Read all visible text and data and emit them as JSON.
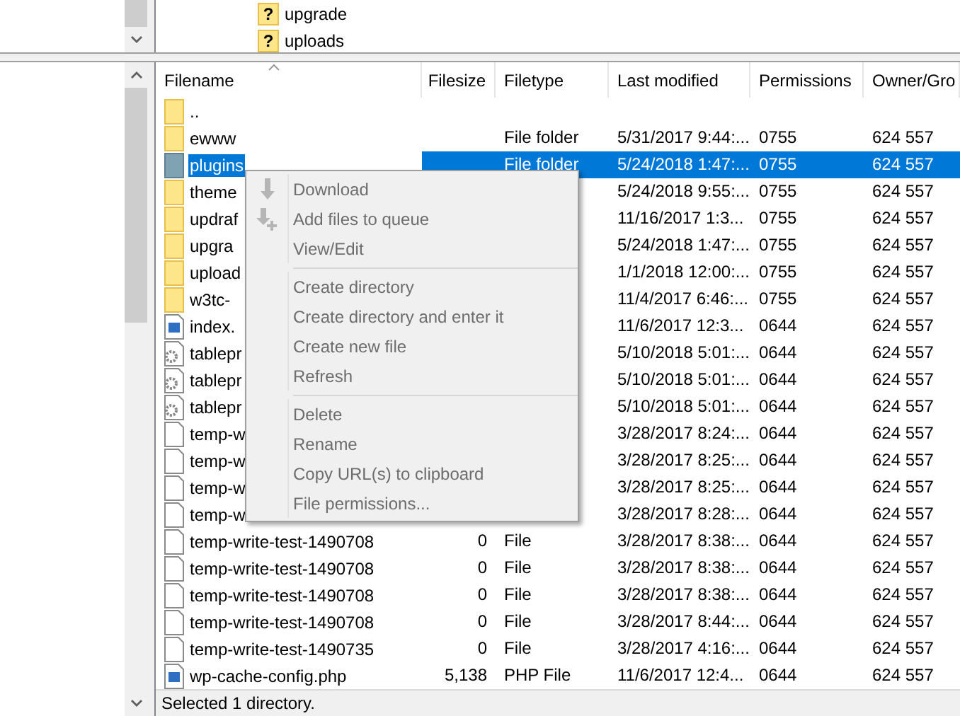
{
  "tree": {
    "items": [
      {
        "mark": "?",
        "label": "upgrade"
      },
      {
        "mark": "?",
        "label": "uploads"
      }
    ]
  },
  "file_list": {
    "columns": [
      {
        "label": "Filename",
        "sorted": true
      },
      {
        "label": "Filesize",
        "sorted": false
      },
      {
        "label": "Filetype",
        "sorted": false
      },
      {
        "label": "Last modified",
        "sorted": false
      },
      {
        "label": "Permissions",
        "sorted": false
      },
      {
        "label": "Owner/Gro",
        "sorted": false
      }
    ],
    "rows": [
      {
        "kind": "folder",
        "name": "..",
        "selected": false
      },
      {
        "kind": "folder",
        "name": "ewww",
        "filetype": "File folder",
        "modified": "5/31/2017 9:44:...",
        "permissions": "0755",
        "owner": "624 557",
        "selected": false
      },
      {
        "kind": "folder",
        "name": "plugins",
        "filetype": "File folder",
        "modified": "5/24/2018 1:47:...",
        "permissions": "0755",
        "owner": "624 557",
        "selected": true
      },
      {
        "kind": "folder",
        "name": "theme",
        "modified": "5/24/2018 9:55:...",
        "permissions": "0755",
        "owner": "624 557",
        "selected": false
      },
      {
        "kind": "folder",
        "name": "updraf",
        "modified": "11/16/2017 1:3...",
        "permissions": "0755",
        "owner": "624 557",
        "selected": false
      },
      {
        "kind": "folder",
        "name": "upgra",
        "modified": "5/24/2018 1:47:...",
        "permissions": "0755",
        "owner": "624 557",
        "selected": false
      },
      {
        "kind": "folder",
        "name": "upload",
        "modified": "1/1/2018 12:00:...",
        "permissions": "0755",
        "owner": "624 557",
        "selected": false
      },
      {
        "kind": "folder",
        "name": "w3tc-",
        "modified": "11/4/2017 6:46:...",
        "permissions": "0755",
        "owner": "624 557",
        "selected": false
      },
      {
        "kind": "php",
        "name": "index.",
        "modified": "11/6/2017 12:3...",
        "permissions": "0644",
        "owner": "624 557",
        "selected": false
      },
      {
        "kind": "gear",
        "name": "tablepr",
        "modified": "5/10/2018 5:01:...",
        "permissions": "0644",
        "owner": "624 557",
        "selected": false
      },
      {
        "kind": "gear",
        "name": "tablepr",
        "modified": "5/10/2018 5:01:...",
        "permissions": "0644",
        "owner": "624 557",
        "selected": false
      },
      {
        "kind": "gear",
        "name": "tablepr",
        "modified": "5/10/2018 5:01:...",
        "permissions": "0644",
        "owner": "624 557",
        "selected": false
      },
      {
        "kind": "file",
        "name": "temp-w",
        "modified": "3/28/2017 8:24:...",
        "permissions": "0644",
        "owner": "624 557",
        "selected": false
      },
      {
        "kind": "file",
        "name": "temp-w",
        "modified": "3/28/2017 8:25:...",
        "permissions": "0644",
        "owner": "624 557",
        "selected": false
      },
      {
        "kind": "file",
        "name": "temp-w",
        "modified": "3/28/2017 8:25:...",
        "permissions": "0644",
        "owner": "624 557",
        "selected": false
      },
      {
        "kind": "file",
        "name": "temp-w",
        "modified": "3/28/2017 8:28:...",
        "permissions": "0644",
        "owner": "624 557",
        "selected": false
      },
      {
        "kind": "file",
        "name": "temp-write-test-1490708",
        "filesize": "0",
        "filetype": "File",
        "modified": "3/28/2017 8:38:...",
        "permissions": "0644",
        "owner": "624 557",
        "selected": false
      },
      {
        "kind": "file",
        "name": "temp-write-test-1490708",
        "filesize": "0",
        "filetype": "File",
        "modified": "3/28/2017 8:38:...",
        "permissions": "0644",
        "owner": "624 557",
        "selected": false
      },
      {
        "kind": "file",
        "name": "temp-write-test-1490708",
        "filesize": "0",
        "filetype": "File",
        "modified": "3/28/2017 8:38:...",
        "permissions": "0644",
        "owner": "624 557",
        "selected": false
      },
      {
        "kind": "file",
        "name": "temp-write-test-1490708",
        "filesize": "0",
        "filetype": "File",
        "modified": "3/28/2017 8:44:...",
        "permissions": "0644",
        "owner": "624 557",
        "selected": false
      },
      {
        "kind": "file",
        "name": "temp-write-test-1490735",
        "filesize": "0",
        "filetype": "File",
        "modified": "3/28/2017 4:16:...",
        "permissions": "0644",
        "owner": "624 557",
        "selected": false
      },
      {
        "kind": "php",
        "name": "wp-cache-config.php",
        "filesize": "5,138",
        "filetype": "PHP File",
        "modified": "11/6/2017 12:4...",
        "permissions": "0644",
        "owner": "624 557",
        "selected": false
      }
    ]
  },
  "context_menu": {
    "items": [
      {
        "kind": "download",
        "label": "Download",
        "disabled": true
      },
      {
        "kind": "queue",
        "label": "Add files to queue",
        "disabled": true
      },
      {
        "kind": "item",
        "label": "View/Edit",
        "disabled": true
      },
      {
        "kind": "separator"
      },
      {
        "kind": "item",
        "label": "Create directory",
        "disabled": true
      },
      {
        "kind": "item",
        "label": "Create directory and enter it",
        "disabled": true
      },
      {
        "kind": "item",
        "label": "Create new file",
        "disabled": true
      },
      {
        "kind": "item",
        "label": "Refresh",
        "disabled": true
      },
      {
        "kind": "separator"
      },
      {
        "kind": "item",
        "label": "Delete",
        "disabled": true
      },
      {
        "kind": "item",
        "label": "Rename",
        "disabled": true
      },
      {
        "kind": "item",
        "label": "Copy URL(s) to clipboard",
        "disabled": true
      },
      {
        "kind": "item",
        "label": "File permissions...",
        "disabled": true
      }
    ]
  },
  "status_bar": "Selected 1 directory."
}
